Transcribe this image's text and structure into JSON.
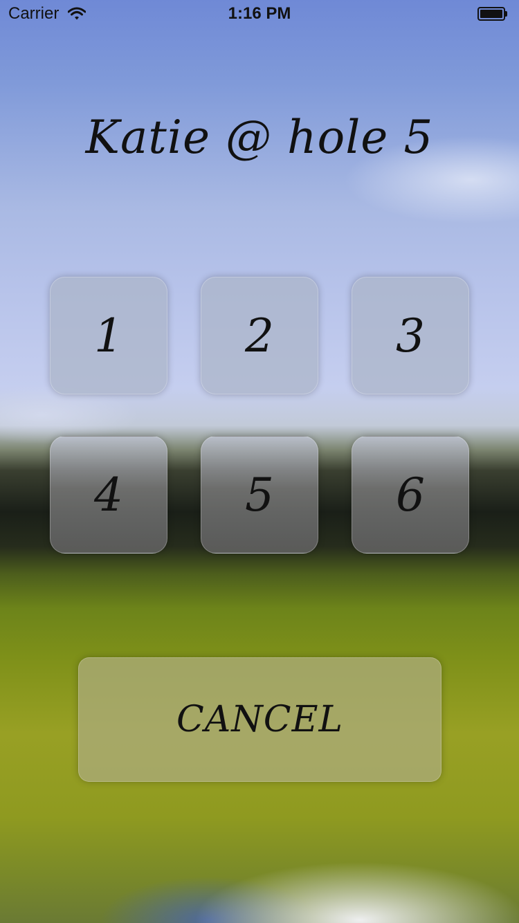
{
  "status_bar": {
    "carrier": "Carrier",
    "wifi_icon": "wifi-icon",
    "time": "1:16 PM",
    "battery_icon": "battery-icon"
  },
  "screen": {
    "title": "Katie @ hole 5"
  },
  "keypad": {
    "keys": [
      "1",
      "2",
      "3",
      "4",
      "5",
      "6"
    ]
  },
  "actions": {
    "cancel_label": "CANCEL"
  },
  "colors": {
    "text": "#111111",
    "sky_top": "#6f89d6",
    "grass": "#7e9019"
  }
}
